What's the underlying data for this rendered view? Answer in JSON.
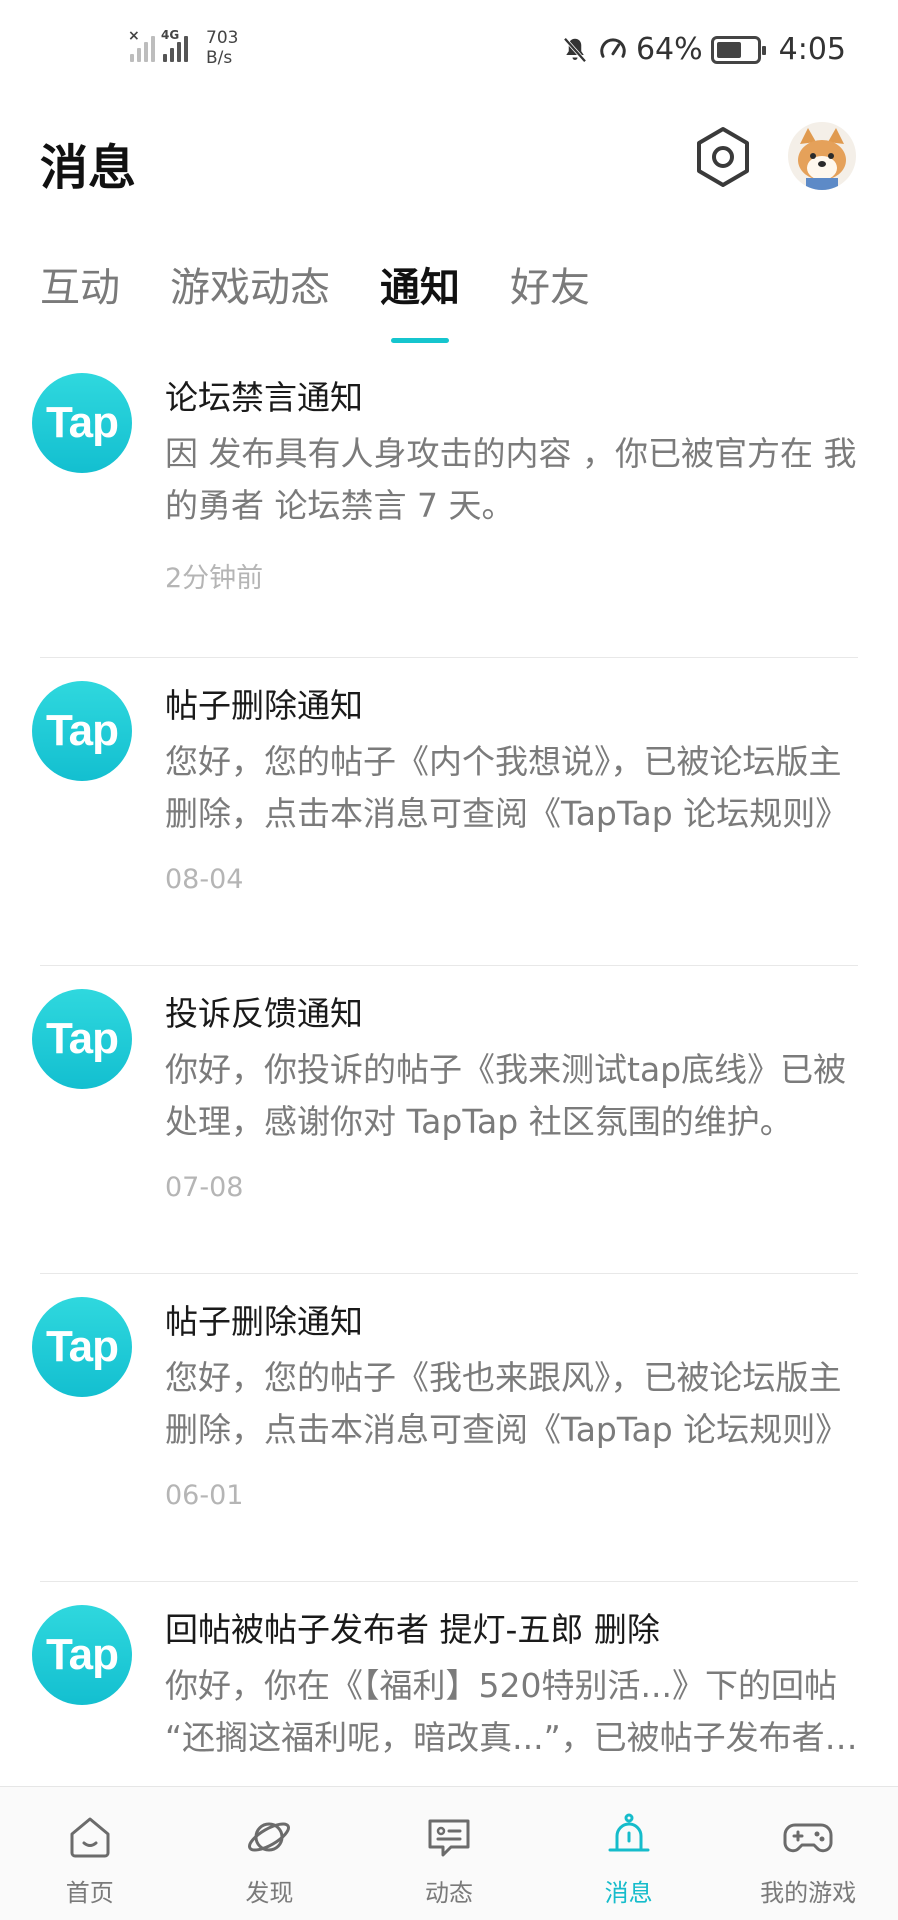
{
  "status_bar": {
    "net_speed_value": "703",
    "net_speed_unit": "B/s",
    "battery": "64%",
    "battery_level": 0.64,
    "time": "4:05",
    "network_label": "4G"
  },
  "header": {
    "title": "消息"
  },
  "tabs": [
    {
      "label": "互动",
      "active": false
    },
    {
      "label": "游戏动态",
      "active": false
    },
    {
      "label": "通知",
      "active": true
    },
    {
      "label": "好友",
      "active": false
    }
  ],
  "notifications": [
    {
      "logo": "Tap",
      "title": "论坛禁言通知",
      "body": "因 发布具有人身攻击的内容 ，你已被官方在 我的勇者 论坛禁言 7 天。",
      "time": "2分钟前"
    },
    {
      "logo": "Tap",
      "title": "帖子删除通知",
      "body": "您好，您的帖子《内个我想说》，已被论坛版主删除，点击本消息可查阅《TapTap 论坛规则》",
      "time": "08-04"
    },
    {
      "logo": "Tap",
      "title": "投诉反馈通知",
      "body": "你好，你投诉的帖子《我来测试tap底线》已被处理，感谢你对 TapTap 社区氛围的维护。",
      "time": "07-08"
    },
    {
      "logo": "Tap",
      "title": "帖子删除通知",
      "body": "您好，您的帖子《我也来跟风》，已被论坛版主删除，点击本消息可查阅《TapTap 论坛规则》",
      "time": "06-01"
    },
    {
      "logo": "Tap",
      "title": "回帖被帖子发布者 提灯-五郎 删除",
      "body": "你好，你在《【福利】520特别活...》下的回帖 “还搁这福利呢，暗改真...”，已被帖子发布者删除",
      "time": ""
    }
  ],
  "bottom_nav": [
    {
      "label": "首页",
      "icon": "home-icon",
      "active": false
    },
    {
      "label": "发现",
      "icon": "planet-icon",
      "active": false
    },
    {
      "label": "动态",
      "icon": "chat-icon",
      "active": false
    },
    {
      "label": "消息",
      "icon": "bell-icon",
      "active": true
    },
    {
      "label": "我的游戏",
      "icon": "gamepad-icon",
      "active": false
    }
  ],
  "colors": {
    "accent": "#15c5ce",
    "logo_gradient_top": "#2fd8de",
    "logo_gradient_bottom": "#13bfd0"
  }
}
